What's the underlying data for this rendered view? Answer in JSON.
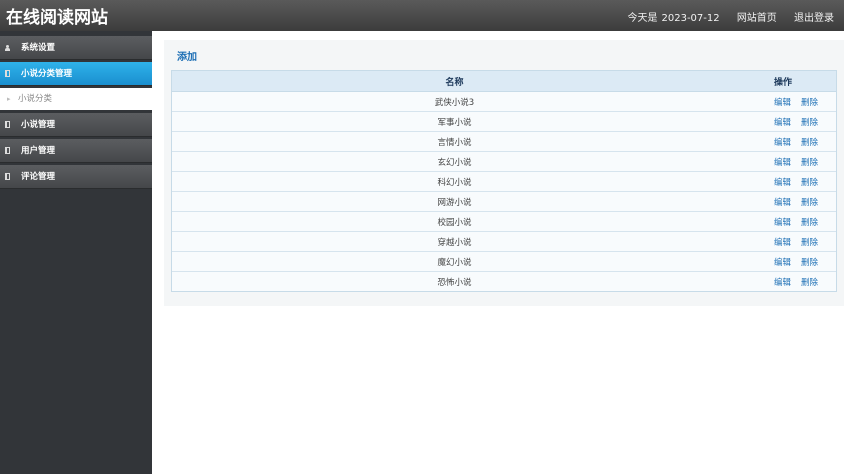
{
  "header": {
    "title": "在线阅读网站",
    "date_label": "今天是",
    "date": "2023-07-12",
    "home_link": "网站首页",
    "logout_link": "退出登录"
  },
  "sidebar": {
    "items": [
      {
        "label": "系统设置",
        "icon": "user-icon",
        "active": false
      },
      {
        "label": "小说分类管理",
        "icon": "folder-icon",
        "active": true
      },
      {
        "label": "小说管理",
        "icon": "folder-icon",
        "active": false
      },
      {
        "label": "用户管理",
        "icon": "folder-icon",
        "active": false
      },
      {
        "label": "评论管理",
        "icon": "folder-icon",
        "active": false
      }
    ],
    "sub_item": {
      "label": "小说分类",
      "icon": "arrow-right-icon"
    }
  },
  "main": {
    "add_link": "添加",
    "table": {
      "headers": {
        "name": "名称",
        "ops": "操作"
      },
      "edit_label": "编辑",
      "delete_label": "删除",
      "rows": [
        {
          "name": "武侠小说3"
        },
        {
          "name": "军事小说"
        },
        {
          "name": "言情小说"
        },
        {
          "name": "玄幻小说"
        },
        {
          "name": "科幻小说"
        },
        {
          "name": "网游小说"
        },
        {
          "name": "校园小说"
        },
        {
          "name": "穿越小说"
        },
        {
          "name": "魔幻小说"
        },
        {
          "name": "恐怖小说"
        }
      ]
    }
  },
  "colors": {
    "header_bg": "#454545",
    "sidebar_bg": "#323539",
    "active_item": "#1f9ad8",
    "link": "#1d6fb5",
    "table_header_bg": "#dceaf5"
  }
}
